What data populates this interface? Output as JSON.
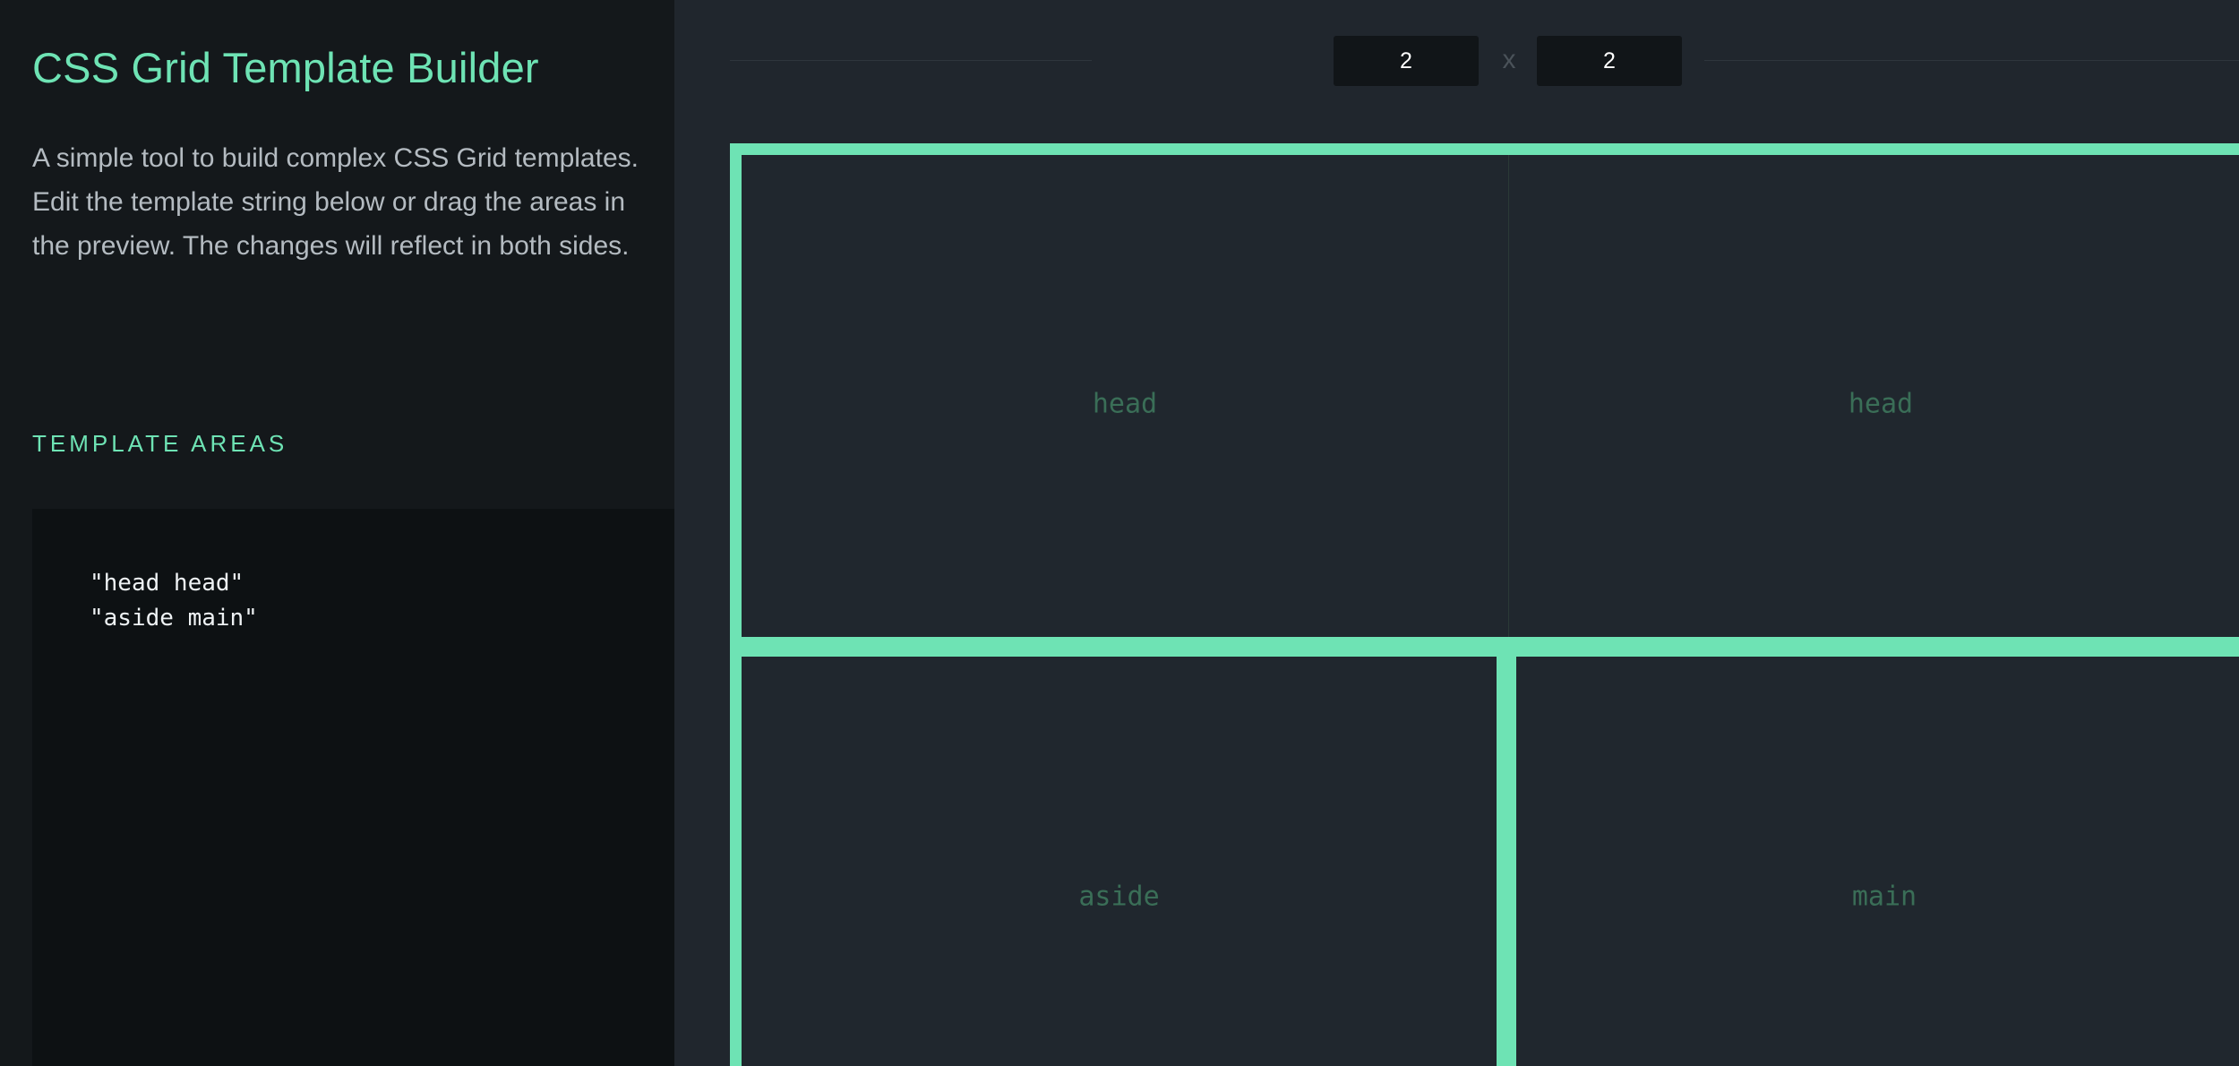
{
  "sidebar": {
    "title": "CSS Grid Template Builder",
    "description": "A simple tool to build complex CSS Grid templates. Edit the template string below or drag the areas in the preview. The changes will reflect in both sides.",
    "section_label": "TEMPLATE AREAS",
    "template_text": "\"head head\"\n\"aside main\""
  },
  "toolbar": {
    "columns_value": "2",
    "rows_value": "2",
    "times_symbol": "x"
  },
  "preview": {
    "areas": [
      {
        "label": "head"
      },
      {
        "label": "head"
      },
      {
        "label": "aside"
      },
      {
        "label": "main"
      }
    ]
  },
  "colors": {
    "accent": "#6ee3b4",
    "sidebar_bg": "#14181b",
    "main_bg": "#20262d",
    "editor_bg": "#0d1113",
    "cell_label": "#3a6e57"
  }
}
